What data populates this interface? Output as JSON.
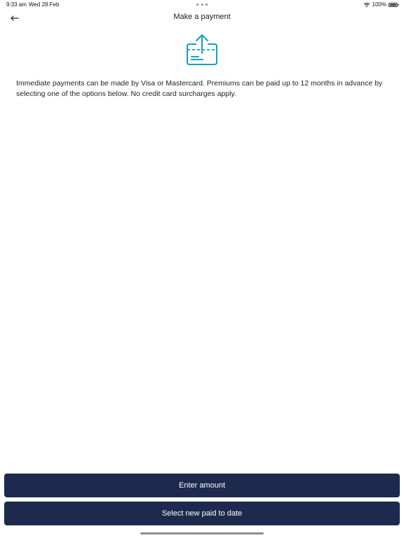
{
  "status_bar": {
    "time": "9:33 am",
    "date": "Wed 28 Feb",
    "battery": "100%",
    "icons": {
      "wifi": "wifi-icon",
      "battery": "battery-icon"
    }
  },
  "header": {
    "back_icon": "arrow-left-icon",
    "title": "Make a payment"
  },
  "hero_icon": "card-upload-icon",
  "intro_text": "Immediate payments can be made by Visa or Mastercard. Premiums can be paid up to 12 months in advance by selecting one of the options below. No credit card surcharges apply.",
  "actions": {
    "enter_amount": "Enter amount",
    "select_new_paid_to_date": "Select new paid to date"
  },
  "colors": {
    "accent": "#1d2a4d",
    "icon_teal": "#159fbe",
    "background": "#ffffff"
  }
}
